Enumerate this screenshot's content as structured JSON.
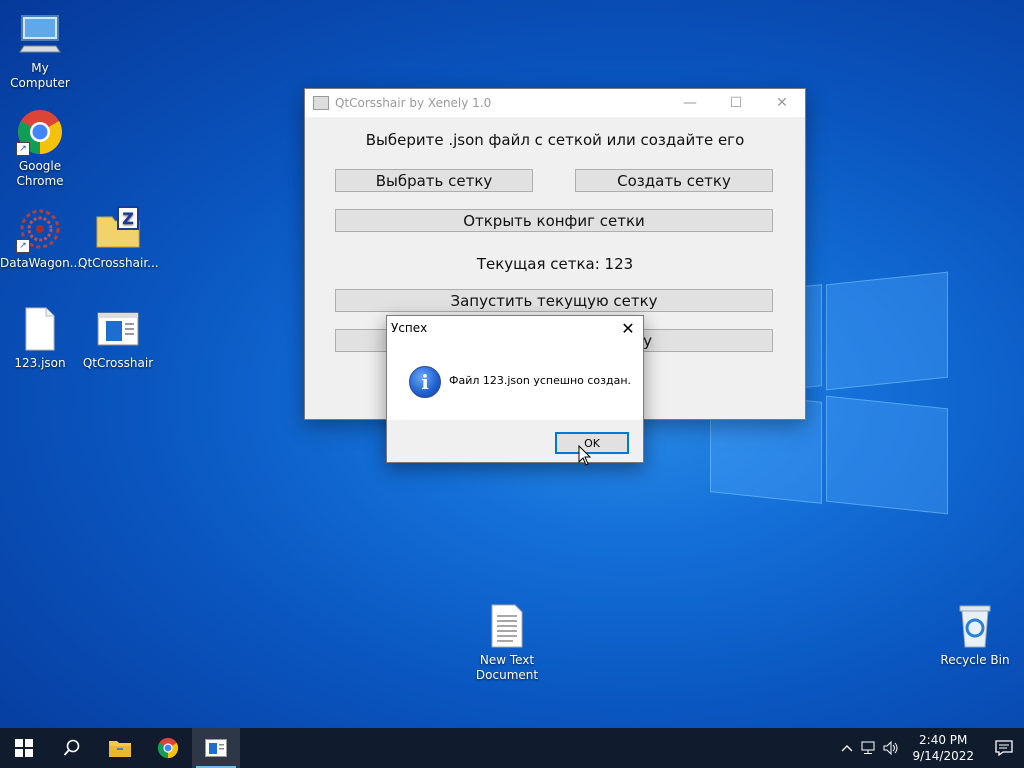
{
  "desktop": {
    "icons": [
      {
        "label": "My Computer"
      },
      {
        "label": "Google Chrome"
      },
      {
        "label": "DataWagon..."
      },
      {
        "label": "QtCrosshair..."
      },
      {
        "label": "123.json"
      },
      {
        "label": "QtCrosshair"
      },
      {
        "label": "New Text Document"
      },
      {
        "label": "Recycle Bin"
      }
    ]
  },
  "qt_window": {
    "title": "QtCorsshair by Xenely 1.0",
    "heading": "Выберите .json файл с сеткой или создайте его",
    "select_grid_label": "Выбрать сетку",
    "create_grid_label": "Создать сетку",
    "open_config_label": "Открыть конфиг сетки",
    "current_grid_text": "Текущая сетка: 123",
    "run_grid_label": "Запустить текущую сетку",
    "hidden_button_tail": "у"
  },
  "message_box": {
    "title": "Успех",
    "text": "Файл 123.json успешно создан.",
    "ok_label": "OK"
  },
  "taskbar": {
    "time": "2:40 PM",
    "date": "9/14/2022"
  },
  "colors": {
    "accent": "#0078d7",
    "taskbar": "#101c2e"
  }
}
